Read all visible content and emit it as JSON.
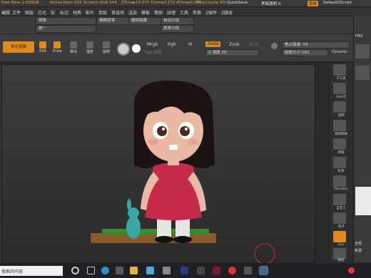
{
  "statusbar": {
    "free_mem": "Free Mem 2.609GB",
    "active_mem": "Active Mem 693",
    "scratch_disk": "Scratch Disk 244",
    "ztime": "ZTime▸15.475 Timer▸0.272 ATime▸0.00T",
    "polycount": "PolyCount▸ 59!",
    "quicksave": "QuickSave",
    "transparency": "界面透明 0",
    "menus_btn": "菜单",
    "default_script": "DefaultZScript"
  },
  "menubar": {
    "items": [
      "编辑",
      "文件",
      "图层",
      "灯光",
      "宏",
      "标记",
      "材质",
      "影片",
      "拾取",
      "首选项",
      "渲染",
      "模板",
      "笔刷",
      "纹理",
      "工具",
      "变换",
      "Z插件",
      "Z脚本"
    ]
  },
  "row2": {
    "mirror": "镜像",
    "unify": "统一",
    "blur_mask": "模糊遮罩",
    "delete_hidden": "删除隐藏",
    "auto_group": "自动分组",
    "polygroup": "遮罩分组"
  },
  "toolbar": {
    "bool_render": "布尔渲染",
    "edit": "Edit",
    "draw": "Draw",
    "move": "移动",
    "scale": "缩放",
    "rotate": "旋转",
    "mrgb": "Mrgb",
    "rgb": "Rgb",
    "m": "M",
    "rgb_intensity": "Rgb 强度",
    "zadd": "Zadd",
    "zsub": "Zsub",
    "zcut": "Zcut",
    "z_intensity": "Z 强度 20",
    "focal_shift": "焦点衰减 -56",
    "draw_size": "绘制大小 192",
    "dynamic": "Dynamic"
  },
  "right_tools": {
    "labels": [
      "子工具",
      "Solo切",
      "透明",
      "透明网格",
      "网格",
      "形状",
      "Dynamic",
      "自定义",
      "顶点",
      "Gyz",
      "按钮"
    ]
  },
  "far_right": {
    "fm": "FM3",
    "panel_label_1": "全部",
    "panel_label_2": "新建"
  },
  "taskbar": {
    "search_text": "搜索的内容",
    "time": " "
  },
  "colors": {
    "accent": "#e08a1e",
    "shirt": "#c52a4c",
    "hair": "#1a1312",
    "skin": "#e9b9a3",
    "grass": "#3a8a2c",
    "toy": "#3aa6a4"
  }
}
